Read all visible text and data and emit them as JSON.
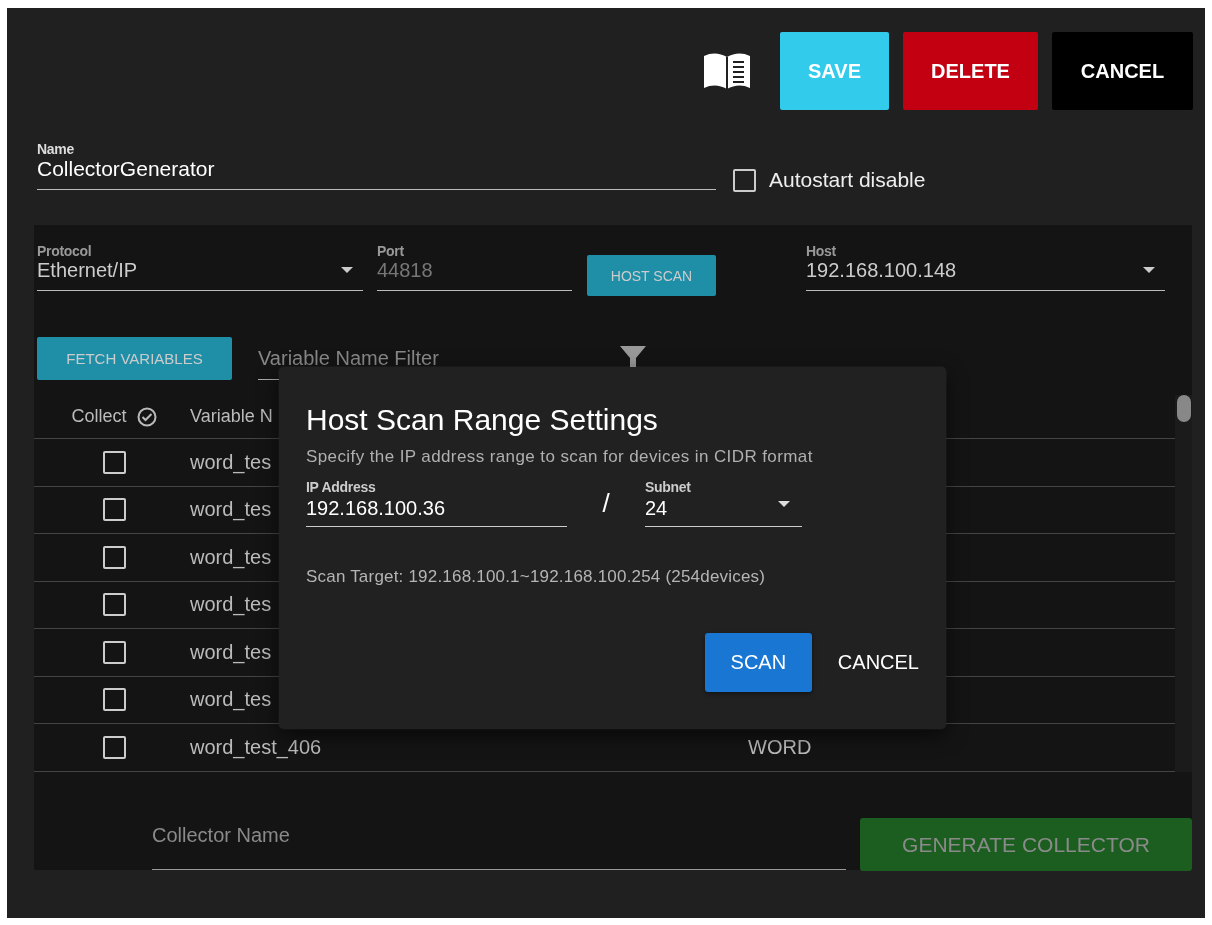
{
  "toolbar": {
    "buttons": [
      {
        "label": "SAVE",
        "kind": "save"
      },
      {
        "label": "DELETE",
        "kind": "delete"
      },
      {
        "label": "CANCEL",
        "kind": "cancel"
      }
    ]
  },
  "name_field": {
    "label": "Name",
    "value": "CollectorGenerator"
  },
  "autostart": {
    "label": "Autostart disable",
    "checked": false
  },
  "connection": {
    "protocol": {
      "label": "Protocol",
      "value": "Ethernet/IP"
    },
    "port": {
      "label": "Port",
      "value": "44818",
      "disabled": true
    },
    "host_scan_button": "HOST SCAN",
    "host": {
      "label": "Host",
      "value": "192.168.100.148"
    }
  },
  "variables": {
    "fetch_button": "FETCH VARIABLES",
    "filter": {
      "placeholder": "Variable Name Filter"
    },
    "columns": [
      "Collect",
      "Variable N"
    ],
    "rows": [
      {
        "checked": false,
        "name": "word_tes"
      },
      {
        "checked": false,
        "name": "word_tes"
      },
      {
        "checked": false,
        "name": "word_tes"
      },
      {
        "checked": false,
        "name": "word_tes"
      },
      {
        "checked": false,
        "name": "word_tes"
      },
      {
        "checked": false,
        "name": "word_tes"
      },
      {
        "checked": false,
        "name": "word_test_406",
        "type": "WORD"
      }
    ]
  },
  "collector": {
    "name_field": {
      "placeholder": "Collector Name"
    },
    "generate_button": {
      "label": "GENERATE COLLECTOR",
      "disabled": true
    }
  },
  "dialog": {
    "title": "Host Scan Range Settings",
    "description": "Specify the IP address range to scan for devices in CIDR format",
    "ip_field": {
      "label": "IP Address",
      "value": "192.168.100.36"
    },
    "separator": "/",
    "subnet": {
      "label": "Subnet",
      "value": "24"
    },
    "scan_target": "Scan Target: 192.168.100.1~192.168.100.254 (254devices)",
    "buttons": [
      {
        "label": "SCAN",
        "kind": "primary"
      },
      {
        "label": "CANCEL",
        "kind": "text"
      }
    ]
  }
}
